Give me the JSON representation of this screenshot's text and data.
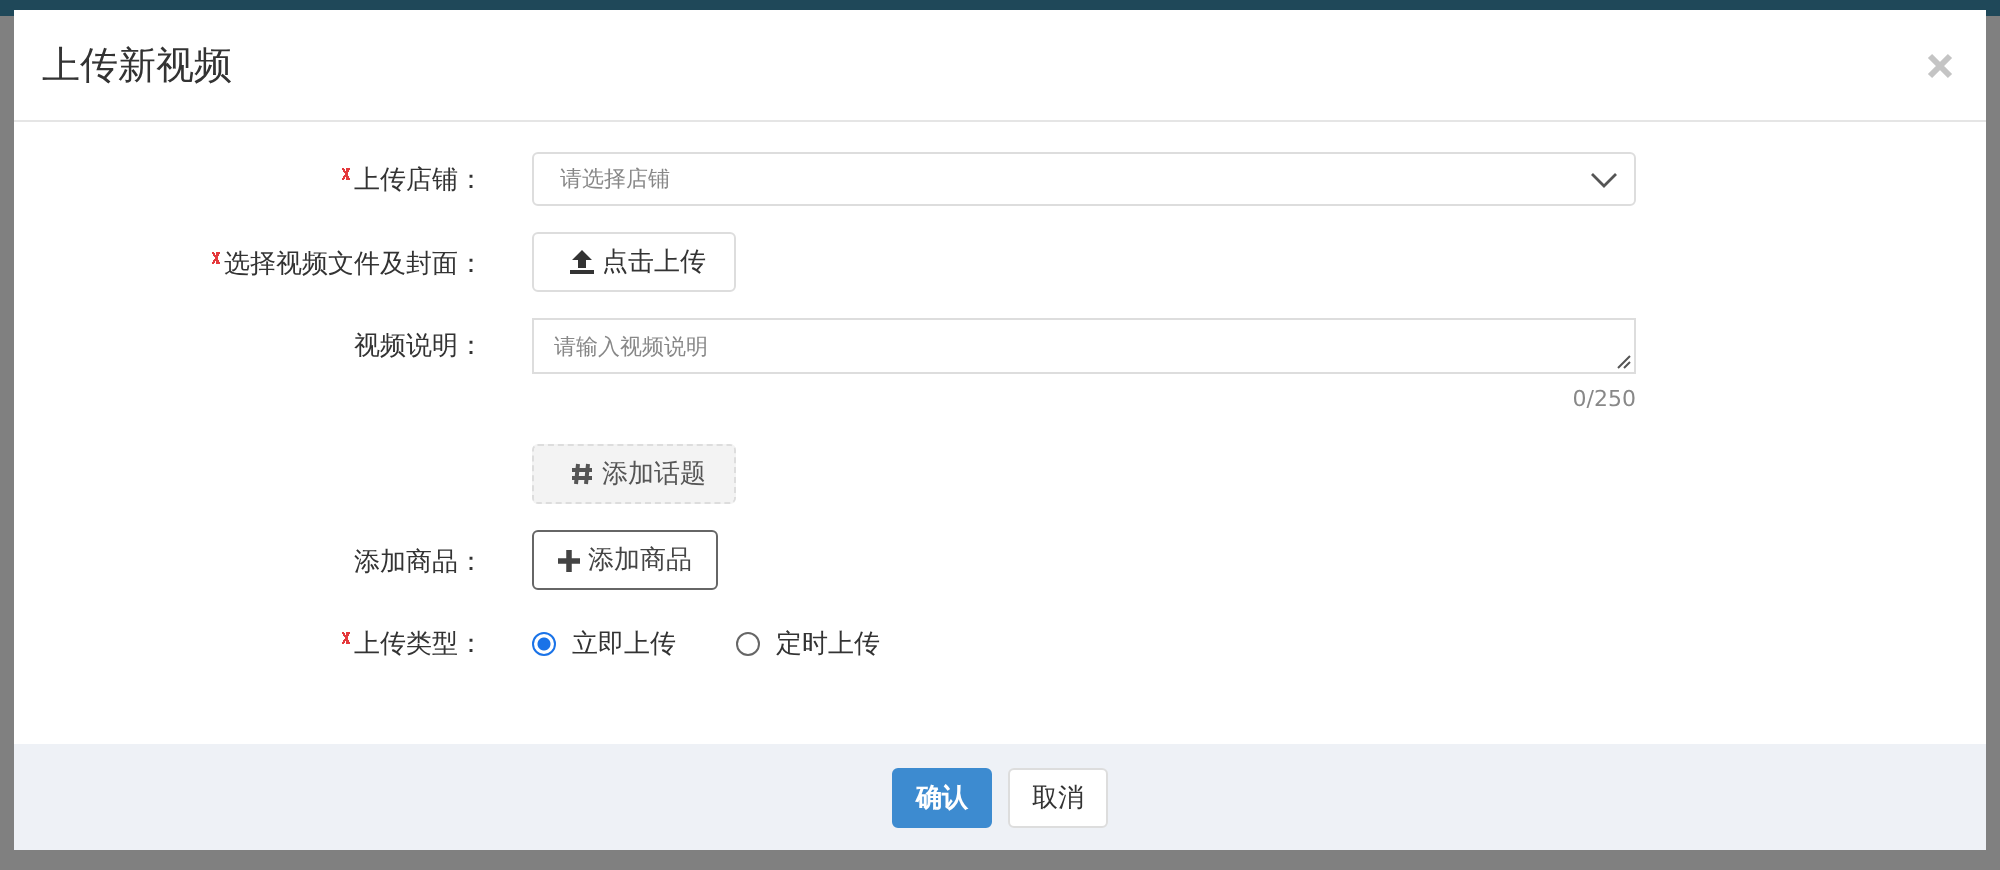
{
  "dialog": {
    "title": "上传新视频",
    "fields": [
      {
        "kind": "select",
        "label": "上传店铺：",
        "required": true,
        "placeholder": "请选择店铺"
      },
      {
        "kind": "upload",
        "label": "选择视频文件及封面：",
        "required": true,
        "button": "点击上传"
      },
      {
        "kind": "textarea",
        "label": "视频说明：",
        "required": false,
        "placeholder": "请输入视频说明",
        "count": "0/250"
      },
      {
        "kind": "topic",
        "button": "添加话题"
      },
      {
        "kind": "product",
        "label": "添加商品：",
        "required": false,
        "button": "添加商品"
      },
      {
        "kind": "radio",
        "label": "上传类型：",
        "required": true,
        "options": [
          {
            "label": "立即上传",
            "selected": true
          },
          {
            "label": "定时上传",
            "selected": false
          }
        ]
      }
    ],
    "buttons": [
      {
        "label": "确认",
        "primary": true
      },
      {
        "label": "取消",
        "primary": false
      }
    ]
  }
}
